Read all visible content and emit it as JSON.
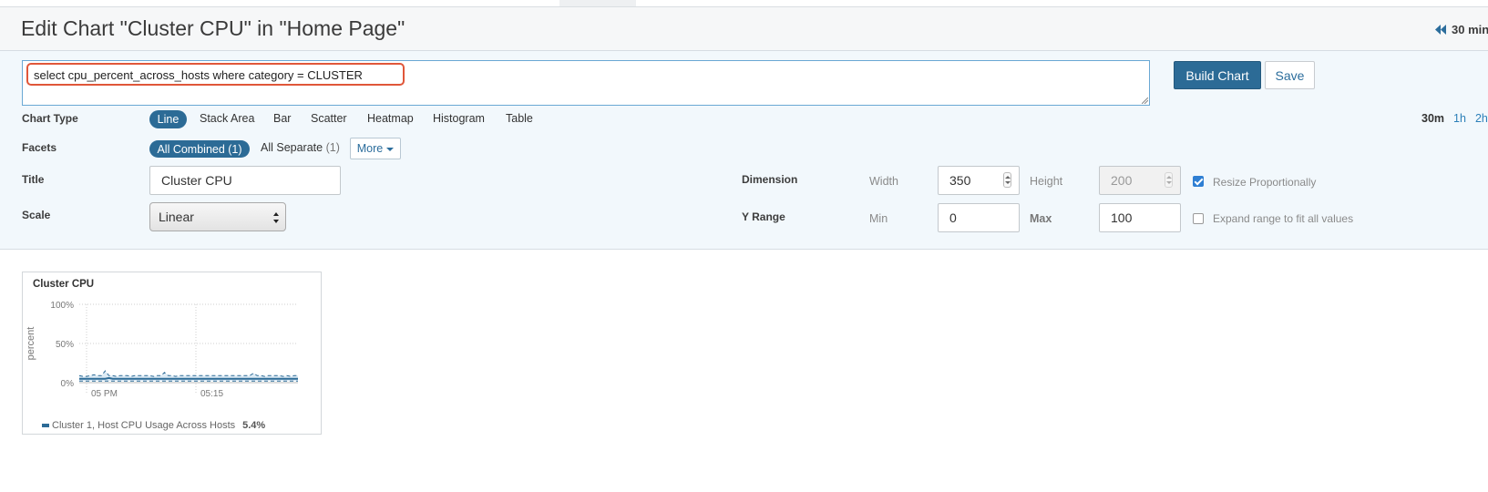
{
  "header": {
    "title": "Edit Chart \"Cluster CPU\" in \"Home Page\"",
    "time_range_label": "30 min"
  },
  "query": {
    "text": "select cpu_percent_across_hosts where category = CLUSTER"
  },
  "actions": {
    "build_label": "Build Chart",
    "save_label": "Save"
  },
  "chart_type": {
    "label": "Chart Type",
    "options": [
      "Line",
      "Stack Area",
      "Bar",
      "Scatter",
      "Heatmap",
      "Histogram",
      "Table"
    ],
    "selected": "Line"
  },
  "time_ranges": {
    "options": [
      "30m",
      "1h",
      "2h"
    ],
    "selected": "30m"
  },
  "facets": {
    "label": "Facets",
    "all_combined": "All Combined (1)",
    "all_separate": "All Separate",
    "all_separate_count": "(1)",
    "more_label": "More"
  },
  "title_field": {
    "label": "Title",
    "value": "Cluster CPU"
  },
  "scale_field": {
    "label": "Scale",
    "value": "Linear"
  },
  "dimension": {
    "label": "Dimension",
    "width_label": "Width",
    "width_value": "350",
    "height_label": "Height",
    "height_value": "200",
    "resize_label": "Resize Proportionally",
    "resize_checked": true
  },
  "y_range": {
    "label": "Y Range",
    "min_label": "Min",
    "min_value": "0",
    "max_label": "Max",
    "max_value": "100",
    "expand_label": "Expand range to fit all values",
    "expand_checked": false
  },
  "preview": {
    "title": "Cluster CPU",
    "legend_label": "Cluster 1, Host CPU Usage Across Hosts",
    "legend_value": "5.4%"
  },
  "colors": {
    "primary": "#2c6b96",
    "query_highlight": "#e0573a",
    "editor_bg": "#f2f8fc",
    "link": "#2b7fb8"
  },
  "chart_data": {
    "type": "line",
    "title": "Cluster CPU",
    "ylabel": "percent",
    "xlabel": "",
    "x_tick_labels": [
      "05 PM",
      "05:15"
    ],
    "y_tick_labels": [
      "100%",
      "50%",
      "0%"
    ],
    "ylim": [
      0,
      100
    ],
    "grid": true,
    "series": [
      {
        "name": "Cluster 1, Host CPU Usage Across Hosts",
        "style": "solid",
        "values": [
          5,
          5,
          5,
          5,
          5,
          5,
          5,
          5,
          6,
          5,
          5,
          5,
          5,
          5,
          5,
          5,
          5,
          5,
          5,
          5,
          5,
          5,
          5,
          5,
          5,
          5,
          5,
          5,
          5,
          5,
          5,
          5,
          5,
          5,
          5,
          5,
          5,
          5,
          5,
          5,
          5,
          5,
          5,
          5,
          5,
          5,
          5,
          5,
          5,
          5,
          5,
          5,
          5,
          5,
          5,
          5,
          5,
          5,
          5,
          5
        ]
      },
      {
        "name": "",
        "style": "dashed",
        "values": [
          9,
          8,
          8,
          9,
          10,
          9,
          9,
          15,
          9,
          9,
          8,
          9,
          9,
          9,
          8,
          9,
          9,
          9,
          9,
          9,
          8,
          9,
          9,
          13,
          9,
          9,
          8,
          9,
          9,
          9,
          9,
          9,
          9,
          9,
          9,
          9,
          9,
          9,
          9,
          9,
          9,
          9,
          9,
          9,
          9,
          9,
          9,
          12,
          9,
          9,
          8,
          9,
          9,
          9,
          9,
          8,
          9,
          8,
          9,
          9
        ]
      },
      {
        "name": "",
        "style": "dashed",
        "values": [
          2,
          2,
          2,
          2,
          2,
          2,
          2,
          2,
          2,
          2,
          2,
          2,
          2,
          2,
          2,
          2,
          2,
          2,
          2,
          2,
          2,
          2,
          2,
          2,
          2,
          2,
          2,
          2,
          2,
          2,
          2,
          2,
          2,
          2,
          2,
          2,
          2,
          2,
          2,
          2,
          2,
          2,
          2,
          2,
          2,
          2,
          2,
          2,
          2,
          2,
          2,
          2,
          2,
          2,
          2,
          2,
          2,
          2,
          2,
          2
        ]
      }
    ]
  }
}
